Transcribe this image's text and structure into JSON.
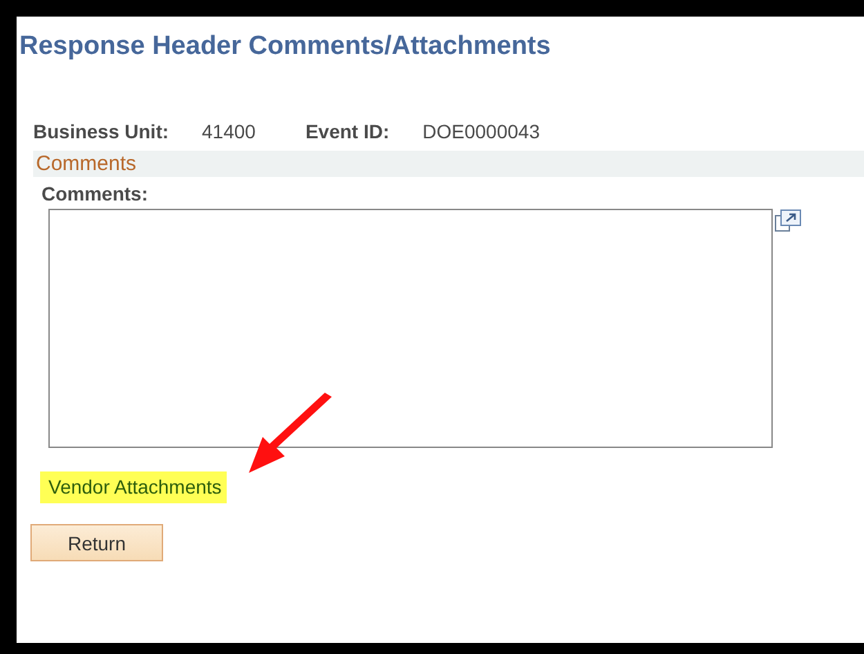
{
  "page": {
    "title": "Response Header Comments/Attachments"
  },
  "fields": [
    {
      "label": "Business Unit:",
      "value": "41400"
    },
    {
      "label": "Event ID:",
      "value": "DOE0000043"
    }
  ],
  "section": {
    "title": "Comments"
  },
  "comments": {
    "label": "Comments:"
  },
  "vendor_link": {
    "label": "Vendor Attachments",
    "highlighted": true,
    "pointer_arrow": true
  },
  "buttons": [
    "Return"
  ]
}
